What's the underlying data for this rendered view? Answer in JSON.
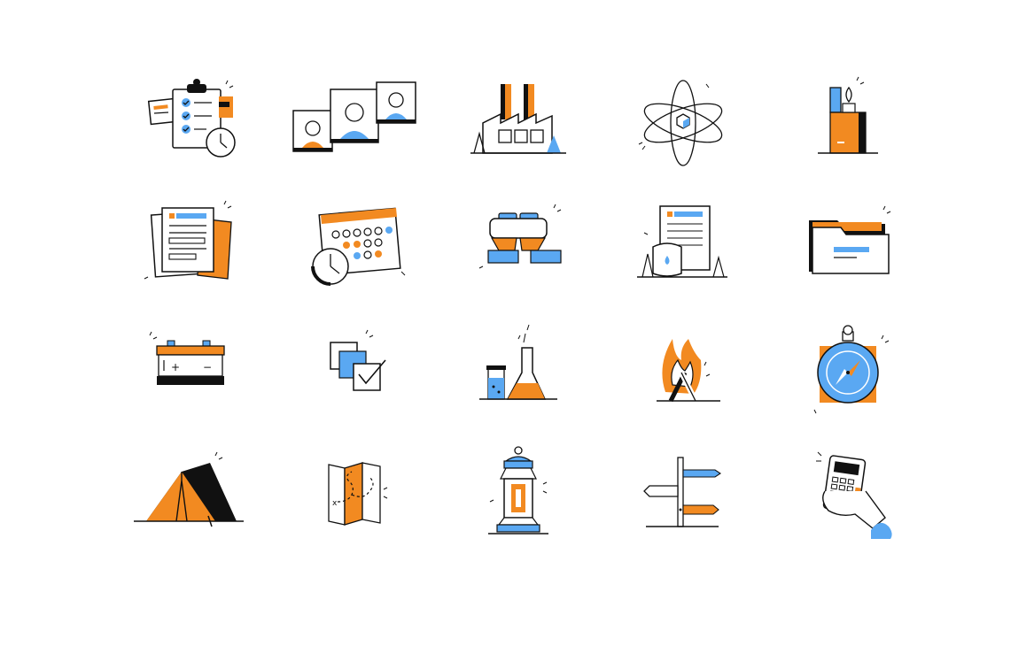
{
  "colors": {
    "ink": "#111111",
    "orange": "#f28a21",
    "blue": "#5aa8f2",
    "navy": "#1b2340",
    "white": "#ffffff"
  },
  "icons": [
    {
      "name": "checklist-clipboard-icon"
    },
    {
      "name": "profile-photos-icon"
    },
    {
      "name": "factory-icon"
    },
    {
      "name": "atom-icon"
    },
    {
      "name": "lighter-icon"
    },
    {
      "name": "documents-icon"
    },
    {
      "name": "calendar-clock-icon"
    },
    {
      "name": "binoculars-icon"
    },
    {
      "name": "water-report-icon"
    },
    {
      "name": "folder-icon"
    },
    {
      "name": "battery-icon"
    },
    {
      "name": "layers-check-icon"
    },
    {
      "name": "chemistry-flasks-icon"
    },
    {
      "name": "campfire-icon"
    },
    {
      "name": "compass-icon"
    },
    {
      "name": "tent-icon"
    },
    {
      "name": "treasure-map-icon"
    },
    {
      "name": "lantern-icon"
    },
    {
      "name": "signpost-icon"
    },
    {
      "name": "calculator-hand-icon"
    }
  ]
}
